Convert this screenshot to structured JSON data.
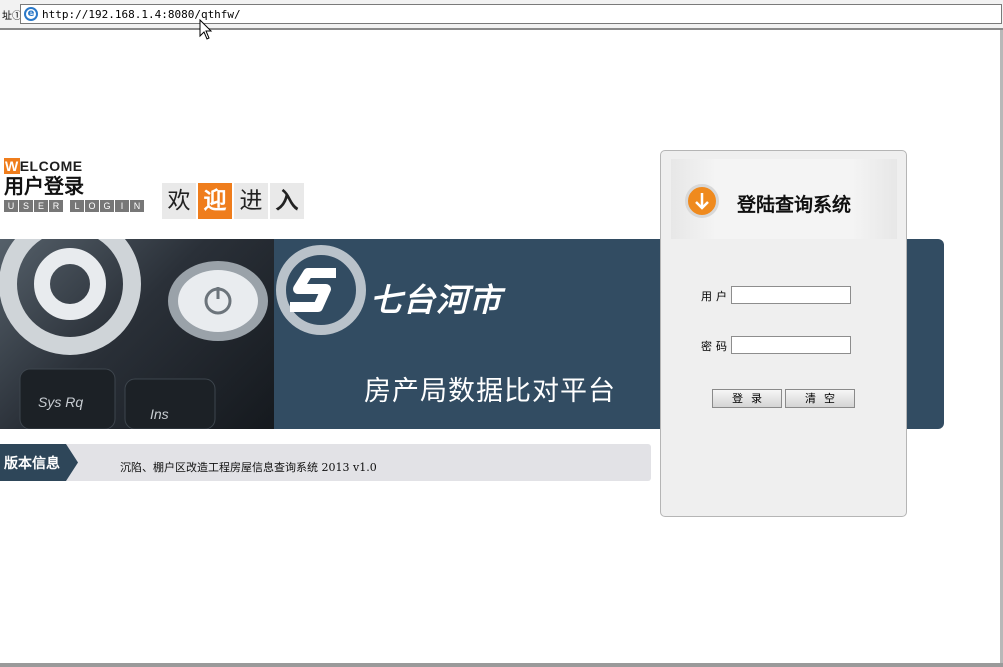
{
  "browser": {
    "address_label": "址①",
    "url": "http://192.168.1.4:8080/qthfw/"
  },
  "welcome": {
    "en_first": "W",
    "en_rest": "ELCOME",
    "cn": "用户登录",
    "user_login_letters": [
      "U",
      "S",
      "E",
      "R",
      "",
      "L",
      "O",
      "G",
      "I",
      "N"
    ],
    "enter_chars": [
      "欢",
      "迎",
      "进",
      "入"
    ]
  },
  "banner": {
    "city": "七台河市",
    "platform": "房产局数据比对平台",
    "photo_key_text_1": "Sys Rq",
    "photo_key_text_2": "Ins"
  },
  "version": {
    "tab_label": "版本信息",
    "text": "沉陷、棚户区改造工程房屋信息查询系统 2013 v1.0"
  },
  "login": {
    "title": "登陆查询系统",
    "username_label": "用户",
    "username_value": "",
    "password_label": "密码",
    "password_value": "",
    "login_button": "登录",
    "clear_button": "清空"
  },
  "colors": {
    "accent_orange": "#ef7d1c",
    "banner_blue": "#324c62",
    "tab_dark": "#2e4659"
  }
}
